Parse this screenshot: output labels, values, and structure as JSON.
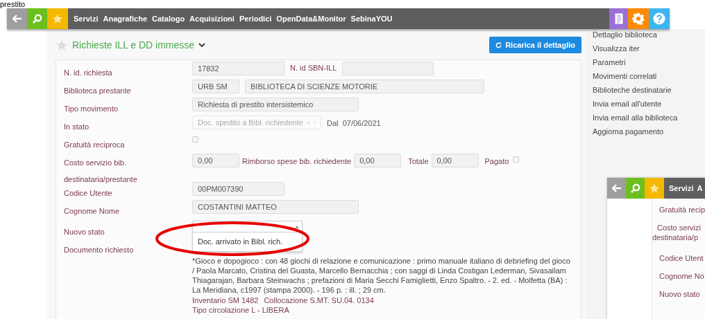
{
  "heading_fragment": "prestito",
  "navbar": {
    "left_buttons": [
      {
        "kind": "back"
      },
      {
        "kind": "search"
      },
      {
        "kind": "favorites"
      }
    ],
    "menu": [
      "Servizi",
      "Anagrafiche",
      "Catalogo",
      "Acquisizioni",
      "Periodici",
      "OpenData&Monitor",
      "SebinaYOU"
    ],
    "right_buttons": [
      {
        "kind": "document"
      },
      {
        "kind": "settings"
      },
      {
        "kind": "help"
      }
    ]
  },
  "page": {
    "title": "Richieste ILL e DD immesse",
    "favorite": false,
    "reload_button": "Ricarica il dettaglio"
  },
  "form": {
    "request_id": {
      "label": "N. id. richiesta",
      "value": "17832"
    },
    "sbn_id": {
      "label": "N. id SBN-ILL"
    },
    "lending_library": {
      "label": "Biblioteca prestante",
      "code": "URB SM",
      "name": "BIBLIOTECA DI SCIENZE MOTORIE"
    },
    "movement_type": {
      "label": "Tipo movimento",
      "value": "Richiesta di prestito intersistemico"
    },
    "status": {
      "label": "In stato",
      "value": "Doc. spedito a Bibl. richiedente",
      "disabled": true,
      "since_label": "Dal",
      "since": "07/06/2021"
    },
    "reciprocal": {
      "label": "Gratuità reciproca",
      "checked": false
    },
    "costs": {
      "label": "Costo servizio bib. destinataria/prestante",
      "service_cost": "0,00",
      "refund_label": "Rimborso spese bib. richiedente",
      "refund": "0,00",
      "total_label": "Totale",
      "total": "0,00",
      "paid_label": "Pagato",
      "paid": false
    },
    "user_code": {
      "label": "Codice Utente",
      "value": "00PM007390"
    },
    "user_name": {
      "label": "Cognome Nome",
      "value": "COSTANTINI MATTEO"
    },
    "new_status": {
      "label": "Nuovo stato",
      "expanded": true,
      "options": [
        "Doc. arrivato in Bibl. rich."
      ]
    },
    "document": {
      "label": "Documento richiesto",
      "description": "*Gioco e dopogioco : con 48 giochi di relazione e comunicazione : primo manuale italiano di debriefing del gioco / Paola Marcato, Cristina del Guasta, Marcello Bernacchia ; con saggi di Linda Costigan Lederman, Sivasailam Thiagarajan, Barbara Steinwachs ; prefazioni di Maria Secchi Famiglietti, Enzo Spaltro. - 2. ed. - Molfetta (BA) : La Meridiana, c1997 (stampa 2000). - 196 p. : ill. ; 29 cm.",
      "inventory_label": "Inventario",
      "inventory": "SM 1482",
      "location_label": "Collocazione",
      "location": "S.MT. SU.04. 0134",
      "circulation": "Tipo circolazione L - LIBERA"
    }
  },
  "sidebar": {
    "links": [
      "Dettaglio biblioteca",
      "Visualizza iter",
      "Parametri",
      "Movimenti correlati",
      "Biblioteche destinatarie",
      "Invia email all'utente",
      "Invia email alla biblioteca",
      "Aggiorna pagamento"
    ]
  },
  "inset": {
    "left_buttons": [
      {
        "kind": "back"
      },
      {
        "kind": "search"
      },
      {
        "kind": "favorites"
      }
    ],
    "menu": [
      "Servizi",
      "A"
    ],
    "labels": [
      "Gratuità recip",
      "Costo servizi",
      "destinataria/p",
      "Codice Utent",
      "Cognome No",
      "Nuovo stato"
    ]
  },
  "annotation": {
    "kind": "ellipse",
    "color": "#e60000"
  }
}
